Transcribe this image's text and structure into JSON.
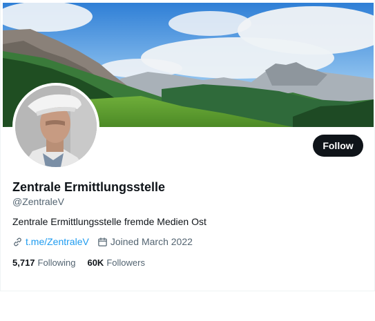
{
  "profile": {
    "display_name": "Zentrale Ermittlungsstelle",
    "handle": "@ZentraleV",
    "bio": "Zentrale Ermittlungsstelle fremde Medien Ost",
    "link": "t.me/ZentraleV",
    "joined": "Joined March 2022"
  },
  "actions": {
    "follow_label": "Follow"
  },
  "stats": {
    "following_count": "5,717",
    "following_label": "Following",
    "followers_count": "60K",
    "followers_label": "Followers"
  },
  "icons": {
    "link": "link-icon",
    "calendar": "calendar-icon"
  },
  "colors": {
    "accent": "#1d9bf0",
    "text": "#0f1419",
    "muted": "#536471",
    "button_bg": "#0f1419"
  }
}
